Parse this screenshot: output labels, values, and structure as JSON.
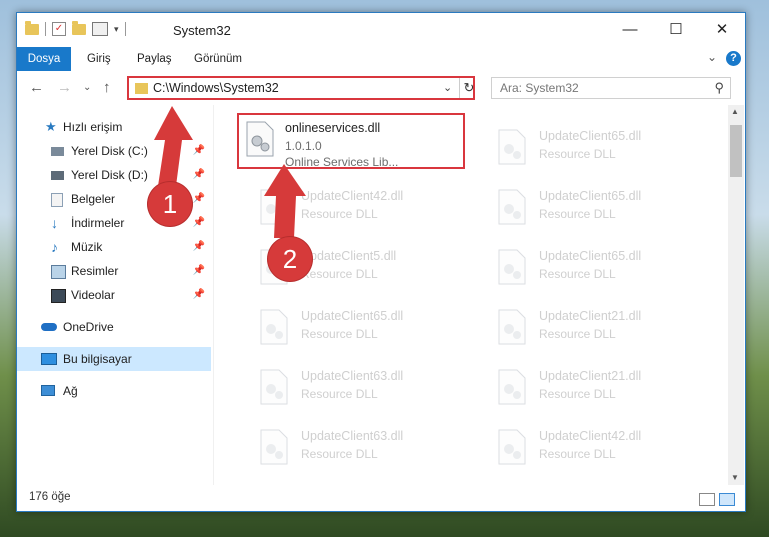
{
  "window": {
    "title": "System32",
    "controls": {
      "minimize": "—",
      "maximize": "☐",
      "close": "✕"
    }
  },
  "ribbon": {
    "tabs": [
      {
        "label": "Dosya"
      },
      {
        "label": "Giriş"
      },
      {
        "label": "Paylaş"
      },
      {
        "label": "Görünüm"
      }
    ],
    "help": "?"
  },
  "address": {
    "path": "C:\\Windows\\System32",
    "search_placeholder": "Ara: System32"
  },
  "sidebar": {
    "quick_access": "Hızlı erişim",
    "items": [
      {
        "label": "Yerel Disk (C:)"
      },
      {
        "label": "Yerel Disk (D:)"
      },
      {
        "label": "Belgeler"
      },
      {
        "label": "İndirmeler"
      },
      {
        "label": "Müzik"
      },
      {
        "label": "Resimler"
      },
      {
        "label": "Videolar"
      }
    ],
    "onedrive": "OneDrive",
    "this_pc": "Bu bilgisayar",
    "network": "Ağ"
  },
  "files": {
    "highlighted": {
      "name": "onlineservices.dll",
      "version": "1.0.1.0",
      "description": "Online Services Lib..."
    },
    "left_column": [
      {
        "name": "UpdateClient42.dll",
        "type": "Resource DLL"
      },
      {
        "name": "UpdateClient5.dll",
        "type": "Resource DLL"
      },
      {
        "name": "UpdateClient65.dll",
        "type": "Resource DLL"
      },
      {
        "name": "UpdateClient63.dll",
        "type": "Resource DLL"
      },
      {
        "name": "UpdateClient63.dll",
        "type": "Resource DLL"
      }
    ],
    "right_column": [
      {
        "name": "UpdateClient65.dll",
        "type": "Resource DLL"
      },
      {
        "name": "UpdateClient65.dll",
        "type": "Resource DLL"
      },
      {
        "name": "UpdateClient65.dll",
        "type": "Resource DLL"
      },
      {
        "name": "UpdateClient21.dll",
        "type": "Resource DLL"
      },
      {
        "name": "UpdateClient21.dll",
        "type": "Resource DLL"
      },
      {
        "name": "UpdateClient42.dll",
        "type": "Resource DLL"
      }
    ]
  },
  "status": {
    "item_count": "176 öğe"
  },
  "annotations": {
    "step1": "1",
    "step2": "2",
    "color": "#d63a3a"
  }
}
